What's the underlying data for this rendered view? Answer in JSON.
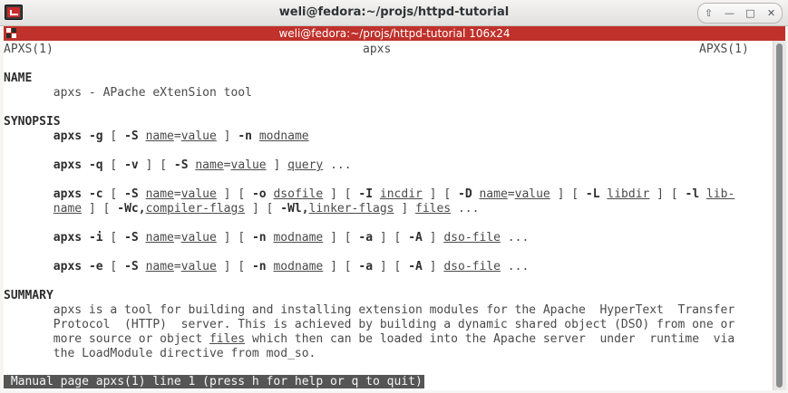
{
  "window": {
    "title": "weli@fedora:~/projs/httpd-tutorial",
    "buttons": {
      "up": "⇧",
      "minimize": "—",
      "maximize": "□",
      "close": "✕"
    }
  },
  "tab": {
    "title": "weli@fedora:~/projs/httpd-tutorial 106x24"
  },
  "colors": {
    "tab_bar": "#c0312b",
    "terminal_bg": "#ffffff",
    "status_bg": "#555555"
  },
  "man": {
    "header": {
      "left": "APXS(1)",
      "center": "apxs",
      "right": "APXS(1)"
    },
    "sections": {
      "name": "NAME",
      "name_desc": "       apxs - APache eXtenSion tool",
      "synopsis": "SYNOPSIS",
      "summary": "SUMMARY"
    },
    "synopsis_lines": [
      [
        [
          "       ",
          ""
        ],
        [
          "apxs",
          "b"
        ],
        [
          " ",
          ""
        ],
        [
          "-g",
          "b"
        ],
        [
          " [ ",
          ""
        ],
        [
          "-S",
          "b"
        ],
        [
          " ",
          ""
        ],
        [
          "name",
          "u"
        ],
        [
          "=",
          ""
        ],
        [
          "value",
          "u"
        ],
        [
          " ] ",
          ""
        ],
        [
          "-n",
          "b"
        ],
        [
          " ",
          ""
        ],
        [
          "modname",
          "u"
        ]
      ],
      [
        [
          "       ",
          ""
        ],
        [
          "apxs",
          "b"
        ],
        [
          " ",
          ""
        ],
        [
          "-q",
          "b"
        ],
        [
          " [ ",
          ""
        ],
        [
          "-v",
          "b"
        ],
        [
          " ] [ ",
          ""
        ],
        [
          "-S",
          "b"
        ],
        [
          " ",
          ""
        ],
        [
          "name",
          "u"
        ],
        [
          "=",
          ""
        ],
        [
          "value",
          "u"
        ],
        [
          " ] ",
          ""
        ],
        [
          "query",
          "u"
        ],
        [
          " ...",
          ""
        ]
      ],
      [
        [
          "       ",
          ""
        ],
        [
          "apxs",
          "b"
        ],
        [
          " ",
          ""
        ],
        [
          "-c",
          "b"
        ],
        [
          " [ ",
          ""
        ],
        [
          "-S",
          "b"
        ],
        [
          " ",
          ""
        ],
        [
          "name",
          "u"
        ],
        [
          "=",
          ""
        ],
        [
          "value",
          "u"
        ],
        [
          " ] [ ",
          ""
        ],
        [
          "-o",
          "b"
        ],
        [
          " ",
          ""
        ],
        [
          "dsofile",
          "u"
        ],
        [
          " ] [ ",
          ""
        ],
        [
          "-I",
          "b"
        ],
        [
          " ",
          ""
        ],
        [
          "incdir",
          "u"
        ],
        [
          " ] [ ",
          ""
        ],
        [
          "-D",
          "b"
        ],
        [
          " ",
          ""
        ],
        [
          "name",
          "u"
        ],
        [
          "=",
          ""
        ],
        [
          "value",
          "u"
        ],
        [
          " ] [ ",
          ""
        ],
        [
          "-L",
          "b"
        ],
        [
          " ",
          ""
        ],
        [
          "libdir",
          "u"
        ],
        [
          " ] [ ",
          ""
        ],
        [
          "-l",
          "b"
        ],
        [
          " ",
          ""
        ],
        [
          "lib-",
          "u"
        ]
      ],
      [
        [
          "       ",
          ""
        ],
        [
          "name",
          "u"
        ],
        [
          " ] [ ",
          ""
        ],
        [
          "-Wc,",
          "b"
        ],
        [
          "compiler-flags",
          "u"
        ],
        [
          " ] [ ",
          ""
        ],
        [
          "-Wl,",
          "b"
        ],
        [
          "linker-flags",
          "u"
        ],
        [
          " ] ",
          ""
        ],
        [
          "files",
          "u"
        ],
        [
          " ...",
          ""
        ]
      ],
      [
        [
          "       ",
          ""
        ],
        [
          "apxs",
          "b"
        ],
        [
          " ",
          ""
        ],
        [
          "-i",
          "b"
        ],
        [
          " [ ",
          ""
        ],
        [
          "-S",
          "b"
        ],
        [
          " ",
          ""
        ],
        [
          "name",
          "u"
        ],
        [
          "=",
          ""
        ],
        [
          "value",
          "u"
        ],
        [
          " ] [ ",
          ""
        ],
        [
          "-n",
          "b"
        ],
        [
          " ",
          ""
        ],
        [
          "modname",
          "u"
        ],
        [
          " ] [ ",
          ""
        ],
        [
          "-a",
          "b"
        ],
        [
          " ] [ ",
          ""
        ],
        [
          "-A",
          "b"
        ],
        [
          " ] ",
          ""
        ],
        [
          "dso-file",
          "u"
        ],
        [
          " ...",
          ""
        ]
      ],
      [
        [
          "       ",
          ""
        ],
        [
          "apxs",
          "b"
        ],
        [
          " ",
          ""
        ],
        [
          "-e",
          "b"
        ],
        [
          " [ ",
          ""
        ],
        [
          "-S",
          "b"
        ],
        [
          " ",
          ""
        ],
        [
          "name",
          "u"
        ],
        [
          "=",
          ""
        ],
        [
          "value",
          "u"
        ],
        [
          " ] [ ",
          ""
        ],
        [
          "-n",
          "b"
        ],
        [
          " ",
          ""
        ],
        [
          "modname",
          "u"
        ],
        [
          " ] [ ",
          ""
        ],
        [
          "-a",
          "b"
        ],
        [
          " ] [ ",
          ""
        ],
        [
          "-A",
          "b"
        ],
        [
          " ] ",
          ""
        ],
        [
          "dso-file",
          "u"
        ],
        [
          " ...",
          ""
        ]
      ]
    ],
    "summary_lines": [
      [
        [
          "       apxs is a tool for building and installing extension modules for the Apache  HyperText  Transfer",
          ""
        ]
      ],
      [
        [
          "       Protocol  (HTTP)  server. This is achieved by building a dynamic shared object (DSO) from one or",
          ""
        ]
      ],
      [
        [
          "       more source or object ",
          ""
        ],
        [
          "files",
          "u"
        ],
        [
          " which then can be loaded into the Apache server  under  runtime  via",
          ""
        ]
      ],
      [
        [
          "       the LoadModule directive from mod_so.",
          ""
        ]
      ]
    ],
    "status": " Manual page apxs(1) line 1 (press h for help or q to quit)"
  }
}
